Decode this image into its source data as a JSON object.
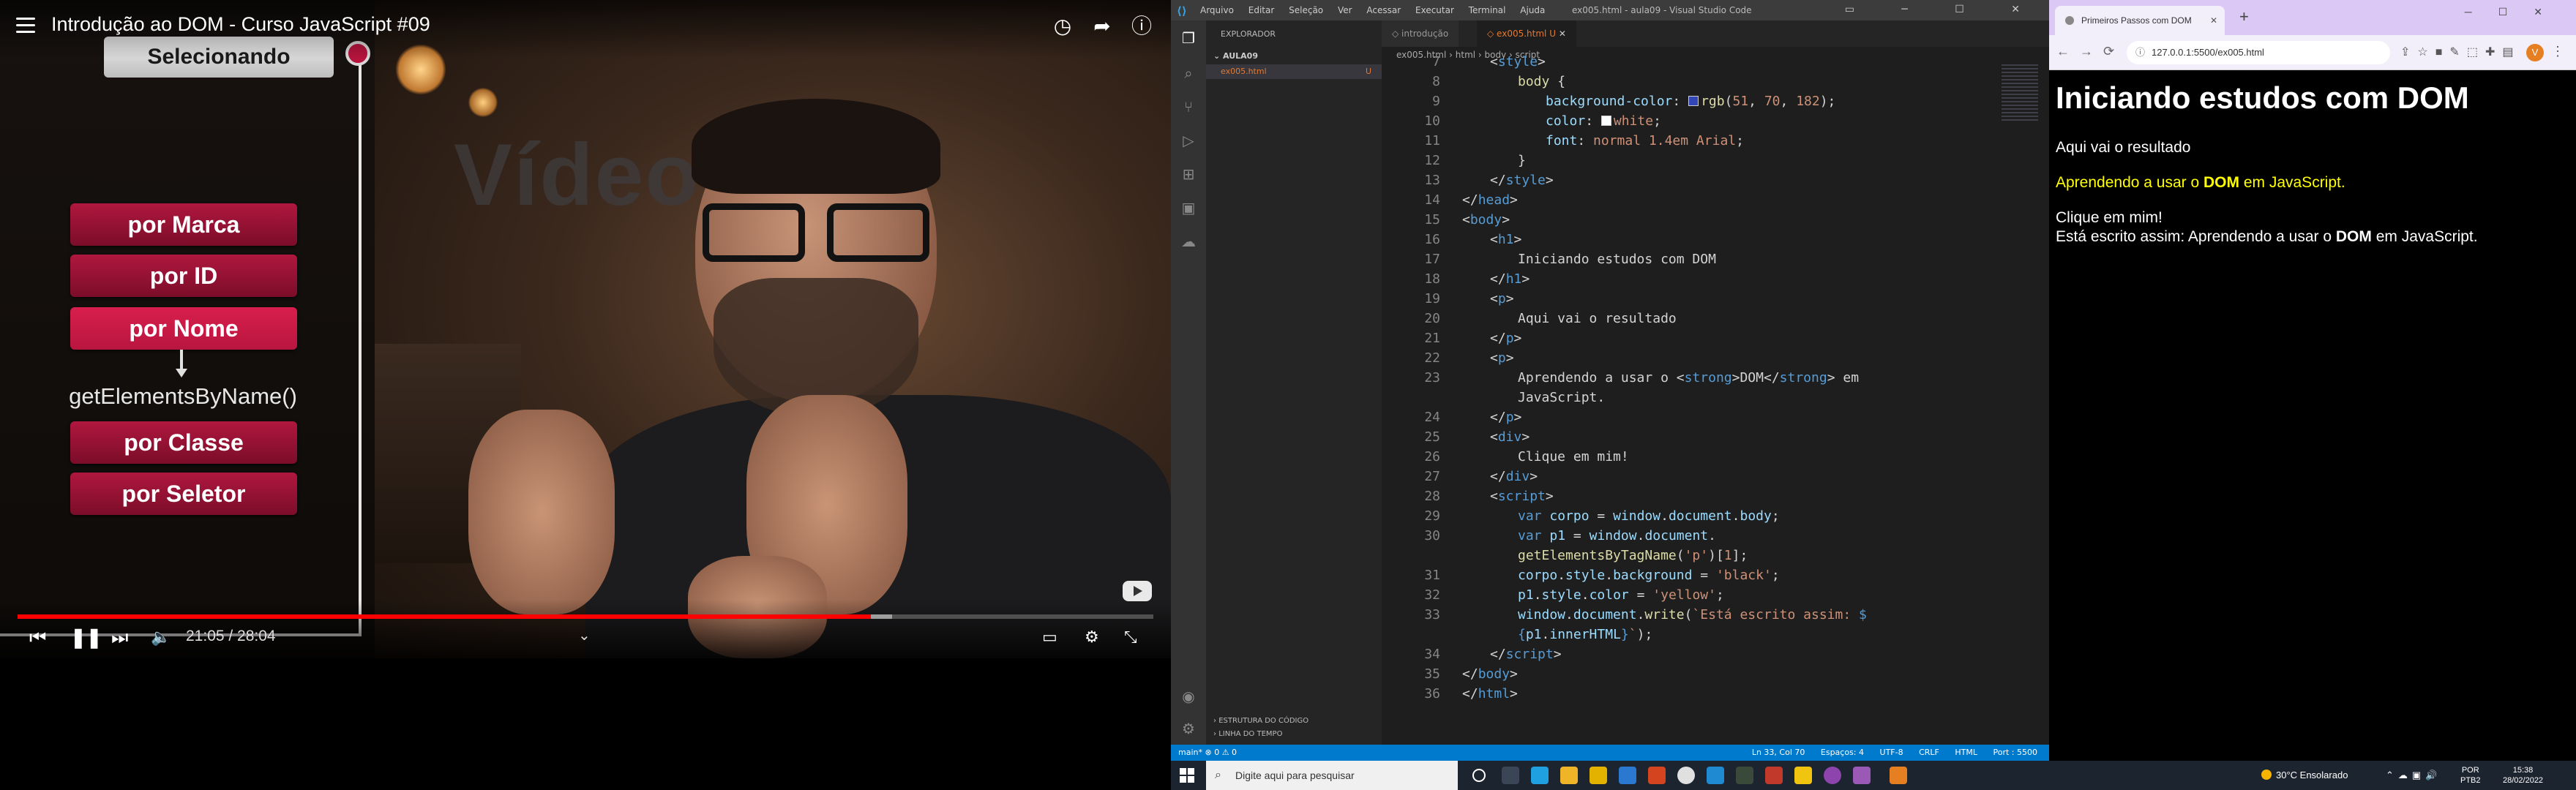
{
  "video": {
    "title": "Introdução ao DOM - Curso JavaScript #09",
    "slide": {
      "selected_label": "Selecionando",
      "buttons": [
        "por Marca",
        "por ID",
        "por Nome",
        "por Classe",
        "por Seletor"
      ],
      "active_button": "por Nome",
      "function_label": "getElementsByName()"
    },
    "background_text": "Vídeo",
    "time_current": "21:05",
    "time_total": "28:04",
    "time_display": "21:05 / 28:04",
    "progress_fraction": 0.7512,
    "buffer_fraction": 0.77,
    "progress_color": "#ff0000"
  },
  "vscode": {
    "window_title": "ex005.html - aula09 - Visual Studio Code",
    "menu": [
      "Arquivo",
      "Editar",
      "Seleção",
      "Ver",
      "Acessar",
      "Executar",
      "Terminal",
      "Ajuda"
    ],
    "explorer_title": "EXPLORADOR",
    "folder": "AULA09",
    "file": "ex005.html",
    "file_status": "U",
    "sections": [
      "ESTRUTURA DO CÓDIGO",
      "LINHA DO TEMPO"
    ],
    "tabs": [
      {
        "label": "introdução"
      },
      {
        "label": "ex005.html",
        "status": "U"
      }
    ],
    "breadcrumb": [
      "ex005.html",
      "html",
      "body",
      "script"
    ],
    "code_lines": [
      {
        "n": "7",
        "html": "<span class='pu'>&lt;</span><span class='t'>style</span><span class='pu'>&gt;</span>",
        "indent": 1
      },
      {
        "n": "8",
        "html": "<span class='f'>body</span> {",
        "indent": 2
      },
      {
        "n": "9",
        "html": "<span class='p'>background-color</span>: <span class='swatch' style='background:rgb(51,70,182)'></span><span class='f'>rgb</span>(<span class='s'>51</span>, <span class='s'>70</span>, <span class='s'>182</span>);",
        "indent": 3
      },
      {
        "n": "10",
        "html": "<span class='p'>color</span>: <span class='swatch' style='background:#fff'></span><span class='s'>white</span>;",
        "indent": 3
      },
      {
        "n": "11",
        "html": "<span class='p'>font</span>: <span class='s'>normal 1.4em Arial</span>;",
        "indent": 3
      },
      {
        "n": "12",
        "html": "}",
        "indent": 2
      },
      {
        "n": "13",
        "html": "<span class='pu'>&lt;/</span><span class='t'>style</span><span class='pu'>&gt;</span>",
        "indent": 1
      },
      {
        "n": "14",
        "html": "<span class='pu'>&lt;/</span><span class='t'>head</span><span class='pu'>&gt;</span>",
        "indent": 0
      },
      {
        "n": "15",
        "html": "<span class='pu'>&lt;</span><span class='t'>body</span><span class='pu'>&gt;</span>",
        "indent": 0
      },
      {
        "n": "16",
        "html": "<span class='pu'>&lt;</span><span class='t'>h1</span><span class='pu'>&gt;</span>",
        "indent": 1
      },
      {
        "n": "17",
        "html": "Iniciando estudos com DOM",
        "indent": 2
      },
      {
        "n": "18",
        "html": "<span class='pu'>&lt;/</span><span class='t'>h1</span><span class='pu'>&gt;</span>",
        "indent": 1
      },
      {
        "n": "19",
        "html": "<span class='pu'>&lt;</span><span class='t'>p</span><span class='pu'>&gt;</span>",
        "indent": 1
      },
      {
        "n": "20",
        "html": "Aqui vai o resultado",
        "indent": 2
      },
      {
        "n": "21",
        "html": "<span class='pu'>&lt;/</span><span class='t'>p</span><span class='pu'>&gt;</span>",
        "indent": 1
      },
      {
        "n": "22",
        "html": "<span class='pu'>&lt;</span><span class='t'>p</span><span class='pu'>&gt;</span>",
        "indent": 1
      },
      {
        "n": "23",
        "html": "Aprendendo a usar o <span class='pu'>&lt;</span><span class='t'>strong</span><span class='pu'>&gt;</span>DOM<span class='pu'>&lt;/</span><span class='t'>strong</span><span class='pu'>&gt;</span> em",
        "indent": 2
      },
      {
        "n": "",
        "html": "JavaScript.",
        "indent": 2
      },
      {
        "n": "24",
        "html": "<span class='pu'>&lt;/</span><span class='t'>p</span><span class='pu'>&gt;</span>",
        "indent": 1
      },
      {
        "n": "25",
        "html": "<span class='pu'>&lt;</span><span class='t'>div</span><span class='pu'>&gt;</span>",
        "indent": 1
      },
      {
        "n": "26",
        "html": "Clique em mim!",
        "indent": 2
      },
      {
        "n": "27",
        "html": "<span class='pu'>&lt;/</span><span class='t'>div</span><span class='pu'>&gt;</span>",
        "indent": 1
      },
      {
        "n": "28",
        "html": "<span class='pu'>&lt;</span><span class='t'>script</span><span class='pu'>&gt;</span>",
        "indent": 1
      },
      {
        "n": "29",
        "html": "<span class='t'>var</span> <span class='v'>corpo</span> = <span class='v'>window</span>.<span class='v'>document</span>.<span class='v'>body</span>;",
        "indent": 2
      },
      {
        "n": "30",
        "html": "<span class='t'>var</span> <span class='v'>p1</span> = <span class='v'>window</span>.<span class='v'>document</span>.",
        "indent": 2
      },
      {
        "n": "",
        "html": "<span class='f'>getElementsByTagName</span>(<span class='s'>'p'</span>)[<span class='s'>1</span>];",
        "indent": 2
      },
      {
        "n": "31",
        "html": "<span class='v'>corpo</span>.<span class='v'>style</span>.<span class='v'>background</span> = <span class='s'>'black'</span>;",
        "indent": 2
      },
      {
        "n": "32",
        "html": "<span class='v'>p1</span>.<span class='v'>style</span>.<span class='v'>color</span> = <span class='s'>'yellow'</span>;",
        "indent": 2
      },
      {
        "n": "33",
        "html": "<span class='v'>window</span>.<span class='v'>document</span>.<span class='f'>write</span>(<span class='s'>`Está escrito assim: </span><span class='t'>$</span>",
        "indent": 2
      },
      {
        "n": "",
        "html": "<span class='t'>{</span><span class='v'>p1</span>.<span class='v'>innerHTML</span><span class='t'>}</span><span class='s'>`</span>);",
        "indent": 2
      },
      {
        "n": "34",
        "html": "<span class='pu'>&lt;/</span><span class='t'>script</span><span class='pu'>&gt;</span>",
        "indent": 1
      },
      {
        "n": "35",
        "html": "<span class='pu'>&lt;/</span><span class='t'>body</span><span class='pu'>&gt;</span>",
        "indent": 0
      },
      {
        "n": "36",
        "html": "<span class='pu'>&lt;/</span><span class='t'>html</span><span class='pu'>&gt;</span>",
        "indent": 0
      }
    ],
    "status_left": "main*   ⊗ 0 ⚠ 0",
    "status_right": [
      "Ln 33, Col 70",
      "Espaços: 4",
      "UTF-8",
      "CRLF",
      "HTML",
      "Port : 5500"
    ]
  },
  "browser": {
    "tab_title": "Primeiros Passos com DOM",
    "url": "127.0.0.1:5500/ex005.html",
    "avatar_letter": "V",
    "page": {
      "h1": "Iniciando estudos com DOM",
      "p1": "Aqui vai o resultado",
      "p2_before": "Aprendendo a usar o ",
      "p2_strong": "DOM",
      "p2_after": " em JavaScript.",
      "div_text": "Clique em mim!",
      "out_before": "Está escrito assim: Aprendendo a usar o ",
      "out_strong": "DOM",
      "out_after": " em JavaScript."
    }
  },
  "taskbar": {
    "search_placeholder": "Digite aqui para pesquisar",
    "weather": "30°C  Ensolarado",
    "lang_line1": "POR",
    "lang_line2": "PTB2",
    "time": "15:38",
    "date": "28/02/2022"
  },
  "colors": {
    "accent_red": "#b5143c",
    "vscode_status": "#007acc",
    "browser_tabbar": "#dcc8f4"
  }
}
